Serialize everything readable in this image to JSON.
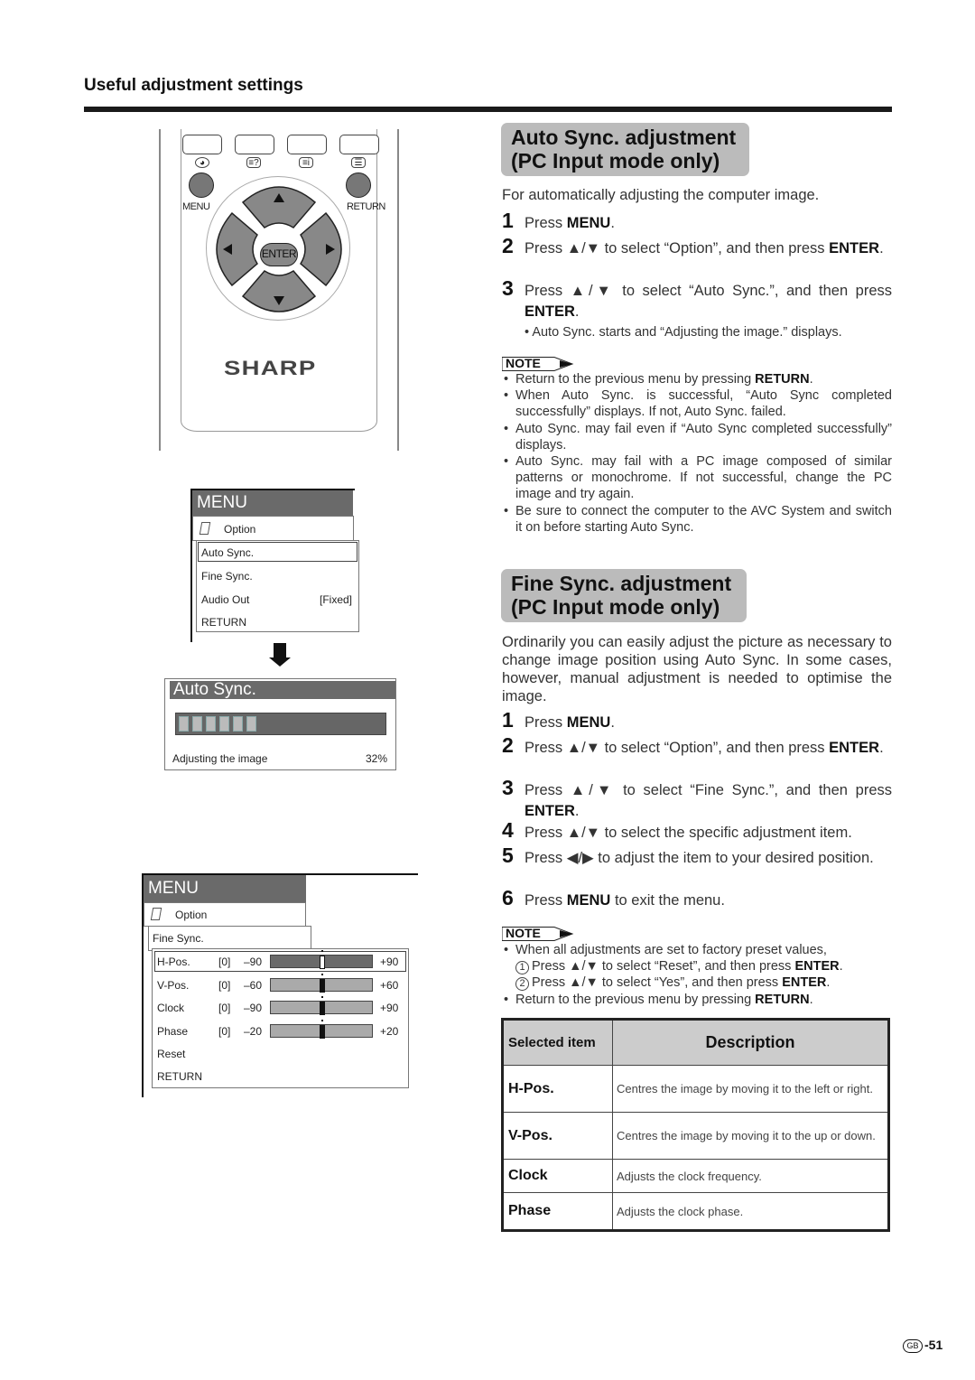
{
  "section_title": "Useful adjustment settings",
  "remote": {
    "function_icons": [
      "color-icon",
      "help-icon",
      "info-icon",
      "menu-list-icon"
    ],
    "function_icon_glyphs": [
      "◕",
      "≡?",
      "≡i",
      "☰"
    ],
    "menu_label": "MENU",
    "return_label": "RETURN",
    "enter_label": "ENTER",
    "brand": "SHARP"
  },
  "menu1": {
    "title": "MENU",
    "category": "Option",
    "items": [
      "Auto Sync.",
      "Fine Sync.",
      "Audio Out",
      "RETURN"
    ],
    "audio_out_value": "[Fixed]",
    "selected": "Auto Sync."
  },
  "auto_sync_panel": {
    "title": "Auto Sync.",
    "status": "Adjusting the image",
    "percent_text": "32%",
    "progress": 0.32,
    "segments_filled": 6
  },
  "menu2": {
    "title": "MENU",
    "category": "Option",
    "submenu": "Fine Sync.",
    "rows": [
      {
        "label": "H-Pos.",
        "value": "[0]",
        "min": "–90",
        "max": "+90",
        "level": 0.5,
        "selected": true
      },
      {
        "label": "V-Pos.",
        "value": "[0]",
        "min": "–60",
        "max": "+60",
        "level": 0.5,
        "selected": false
      },
      {
        "label": "Clock",
        "value": "[0]",
        "min": "–90",
        "max": "+90",
        "level": 0.5,
        "selected": false
      },
      {
        "label": "Phase",
        "value": "[0]",
        "min": "–20",
        "max": "+20",
        "level": 0.5,
        "selected": false
      }
    ],
    "reset_label": "Reset",
    "return_label": "RETURN"
  },
  "auto_sync": {
    "heading_line1": "Auto Sync. adjustment",
    "heading_line2": "(PC Input mode only)",
    "intro": "For automatically adjusting the computer image.",
    "steps": [
      {
        "num": "1",
        "pre": "Press ",
        "bold": "MENU",
        "post": "."
      },
      {
        "num": "2",
        "pre": "Press ▲/▼ to select “Option”, and then press ",
        "bold": "ENTER",
        "post": "."
      },
      {
        "num": "3",
        "pre": "Press ▲/▼ to select “Auto Sync.”, and then press ",
        "bold": "ENTER",
        "post": "."
      }
    ],
    "step3_bullet": "Auto Sync. starts and “Adjusting the image.” displays.",
    "note_label": "NOTE",
    "notes": [
      {
        "pre": "Return to the previous menu by pressing ",
        "bold": "RETURN",
        "post": "."
      },
      {
        "pre": "When Auto Sync. is successful, “Auto Sync completed successfully” displays. If not, Auto Sync. failed.",
        "bold": "",
        "post": ""
      },
      {
        "pre": "Auto Sync. may fail even if “Auto Sync completed successfully” displays.",
        "bold": "",
        "post": ""
      },
      {
        "pre": "Auto Sync. may fail with a PC image composed of similar patterns or monochrome. If not successful, change the PC image and try again.",
        "bold": "",
        "post": ""
      },
      {
        "pre": "Be sure to connect the computer to the AVC System and switch it on before starting Auto Sync.",
        "bold": "",
        "post": ""
      }
    ]
  },
  "fine_sync": {
    "heading_line1": "Fine Sync. adjustment",
    "heading_line2": "(PC Input mode only)",
    "intro": "Ordinarily you can easily adjust the picture as necessary to change image position using Auto Sync. In some cases, however, manual adjustment is needed to optimise the image.",
    "steps": [
      {
        "num": "1",
        "pre": "Press ",
        "bold": "MENU",
        "post": "."
      },
      {
        "num": "2",
        "pre": "Press ▲/▼ to select “Option”, and then press ",
        "bold": "ENTER",
        "post": "."
      },
      {
        "num": "3",
        "pre": "Press ▲/▼ to select “Fine Sync.”, and then press ",
        "bold": "ENTER",
        "post": "."
      },
      {
        "num": "4",
        "pre": "Press ▲/▼ to select the specific adjustment item.",
        "bold": "",
        "post": ""
      },
      {
        "num": "5",
        "pre": "Press ◀/▶ to adjust the item to your desired position.",
        "bold": "",
        "post": ""
      },
      {
        "num": "6",
        "pre": "Press ",
        "bold": "MENU",
        "post": " to exit the menu."
      }
    ],
    "note_label": "NOTE",
    "note1": "When all adjustments are set to factory preset values,",
    "note1_sub": [
      {
        "mark": "1",
        "pre": "Press ▲/▼ to select “Reset”, and then press ",
        "bold": "ENTER",
        "post": "."
      },
      {
        "mark": "2",
        "pre": "Press ▲/▼ to select “Yes”, and then press ",
        "bold": "ENTER",
        "post": "."
      }
    ],
    "note2": {
      "pre": "Return to the previous menu by pressing ",
      "bold": "RETURN",
      "post": "."
    }
  },
  "table": {
    "headers": [
      "Selected item",
      "Description"
    ],
    "rows": [
      {
        "item": "H-Pos.",
        "desc": "Centres the image by moving it to the left or right."
      },
      {
        "item": "V-Pos.",
        "desc": "Centres the image by moving it to the up or down."
      },
      {
        "item": "Clock",
        "desc": "Adjusts the clock frequency."
      },
      {
        "item": "Phase",
        "desc": "Adjusts the clock phase."
      }
    ]
  },
  "footer": {
    "region_badge": "GB",
    "page_number": "-51"
  }
}
